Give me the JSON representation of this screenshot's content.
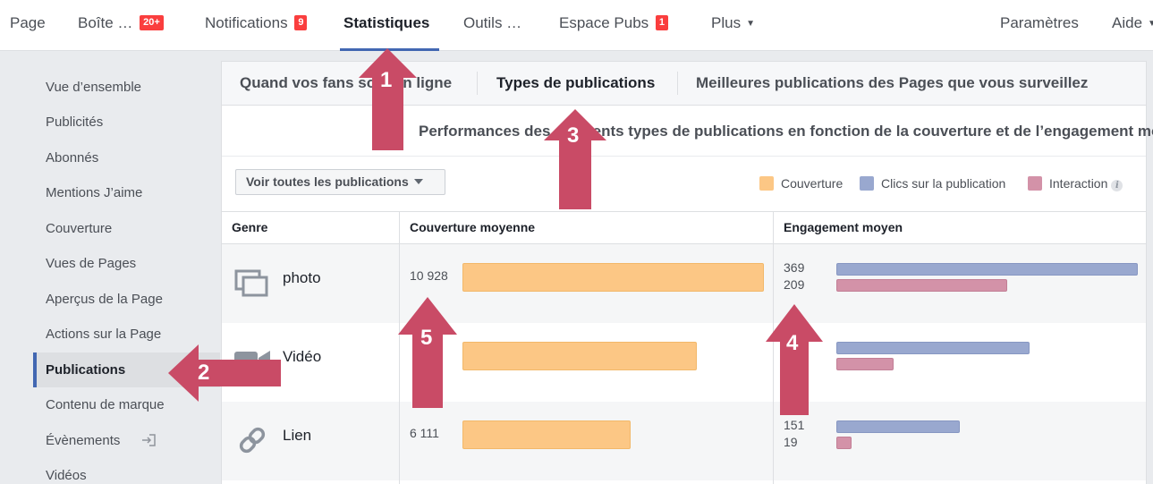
{
  "nav": {
    "items": [
      {
        "label": "Page"
      },
      {
        "label": "Boîte …",
        "badge": "20+"
      },
      {
        "label": "Notifications",
        "badge": "9"
      },
      {
        "label": "Statistiques"
      },
      {
        "label": "Outils …"
      },
      {
        "label": "Espace Pubs",
        "badge": "1"
      },
      {
        "label": "Plus"
      }
    ],
    "right": [
      "Paramètres",
      "Aide"
    ]
  },
  "sidebar": {
    "items": [
      {
        "label": "Vue d’ensemble"
      },
      {
        "label": "Publicités"
      },
      {
        "label": "Abonnés"
      },
      {
        "label": "Mentions J’aime"
      },
      {
        "label": "Couverture"
      },
      {
        "label": "Vues de Pages"
      },
      {
        "label": "Aperçus de la Page"
      },
      {
        "label": "Actions sur la Page"
      },
      {
        "label": "Publications"
      },
      {
        "label": "Contenu de marque"
      },
      {
        "label": "Évènements"
      },
      {
        "label": "Vidéos"
      }
    ],
    "active": "Publications"
  },
  "tabs": [
    {
      "label": "Quand vos fans sont en ligne"
    },
    {
      "label": "Types de publications"
    },
    {
      "label": "Meilleures publications des Pages que vous surveillez"
    }
  ],
  "subtitle": "Performances des différents types de publications en fonction de la couverture et de l’engagement moyens.",
  "filter": {
    "label": "Voir toutes les publications"
  },
  "legend": [
    {
      "label": "Couverture",
      "color": "#fcc785"
    },
    {
      "label": "Clics sur la publication",
      "color": "#99a8cf"
    },
    {
      "label": "Interaction",
      "color": "#d392a8"
    }
  ],
  "table": {
    "headers": [
      "Genre",
      "Couverture moyenne",
      "Engagement moyen"
    ],
    "rows": [
      {
        "type": "photo",
        "icon": "photo-icon",
        "reach": "10 928",
        "reach_value": 10928,
        "clicks": "369",
        "clicks_value": 369,
        "interactions": "209",
        "interactions_value": 209
      },
      {
        "type": "Vidéo",
        "icon": "video-icon",
        "reach": "",
        "reach_value": 8500,
        "clicks": "",
        "clicks_value": 236,
        "interactions": "",
        "interactions_value": 70
      },
      {
        "type": "Lien",
        "icon": "link-icon",
        "reach": "6 111",
        "reach_value": 6111,
        "clicks": "151",
        "clicks_value": 151,
        "interactions": "19",
        "interactions_value": 19
      }
    ]
  },
  "annotations": [
    "1",
    "2",
    "3",
    "4",
    "5"
  ],
  "colors": {
    "accent": "#4267b2",
    "badge": "#fa3e3e",
    "arrow": "#c94b66"
  }
}
